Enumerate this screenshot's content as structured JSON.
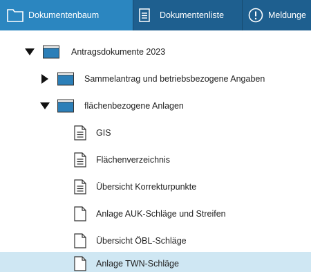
{
  "tabs": [
    {
      "label": "Dokumentenbaum",
      "icon": "folder-icon",
      "active": true
    },
    {
      "label": "Dokumentenliste",
      "icon": "list-document-icon",
      "active": false
    },
    {
      "label": "Meldunge",
      "icon": "alert-circle-icon",
      "active": false
    }
  ],
  "tree": {
    "root": {
      "label": "Antragsdokumente 2023",
      "expanded": true
    },
    "folders": [
      {
        "label": "Sammelantrag und betriebsbezogene Angaben",
        "expanded": false
      },
      {
        "label": "flächenbezogene Anlagen",
        "expanded": true
      }
    ],
    "documents": [
      {
        "label": "GIS",
        "has_content": true
      },
      {
        "label": "Flächenverzeichnis",
        "has_content": true
      },
      {
        "label": "Übersicht Korrekturpunkte",
        "has_content": true
      },
      {
        "label": "Anlage AUK-Schläge und Streifen",
        "has_content": false
      },
      {
        "label": "Übersicht ÖBL-Schläge",
        "has_content": false
      },
      {
        "label": "Anlage TWN-Schläge",
        "has_content": false,
        "selected": true
      }
    ]
  },
  "colors": {
    "tabbar": "#1e5f8f",
    "tab_active": "#2b86c0",
    "selection": "#cfe7f3",
    "folder": "#2c7fb8"
  }
}
